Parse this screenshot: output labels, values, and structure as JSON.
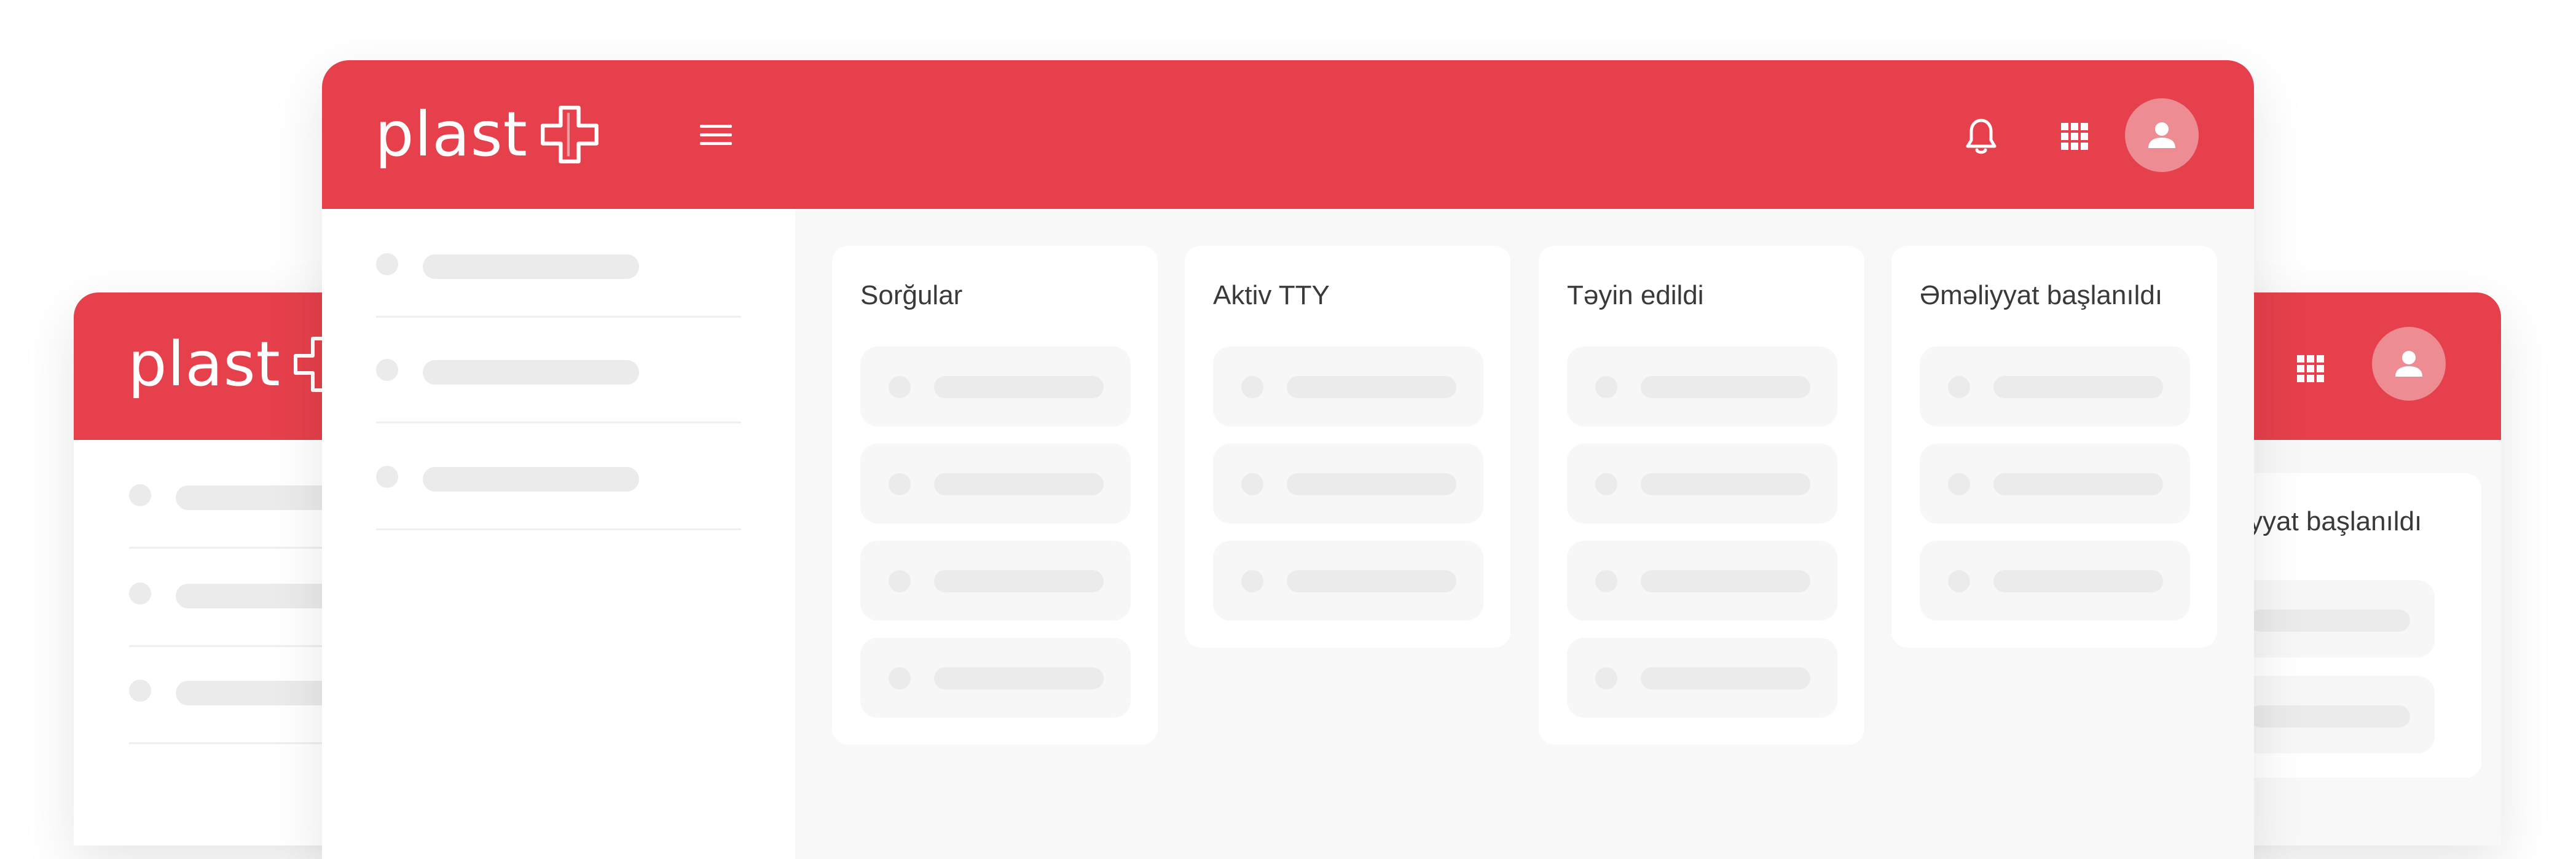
{
  "brand": {
    "name": "plast",
    "accent": "#E5404B",
    "avatar_bg": "#EE8C93"
  },
  "header": {
    "icons": [
      "menu-icon",
      "bell-icon",
      "apps-grid-icon",
      "user-icon"
    ]
  },
  "board": {
    "columns": [
      {
        "title": "Sorğular"
      },
      {
        "title": "Aktiv TTY"
      },
      {
        "title": "Təyin edildi"
      },
      {
        "title": "Əməliyyat başlanıldı"
      }
    ]
  },
  "back_window": {
    "visible_column_title": "yyat başlanıldı"
  }
}
